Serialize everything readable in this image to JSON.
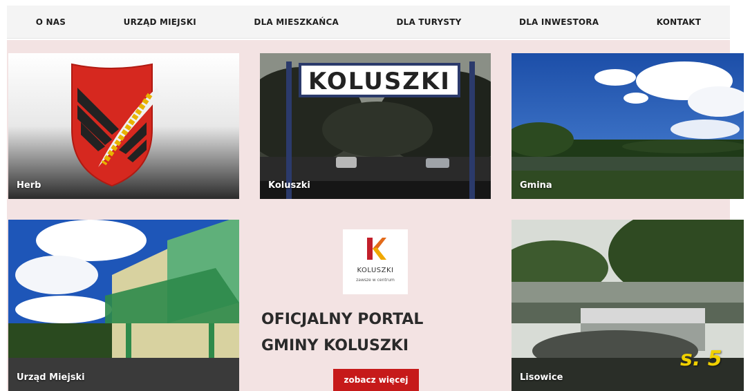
{
  "nav": {
    "items": [
      {
        "label": "O NAS"
      },
      {
        "label": "URZĄD MIEJSKI"
      },
      {
        "label": "DLA MIESZKAŃCA"
      },
      {
        "label": "DLA TURYSTY"
      },
      {
        "label": "DLA INWESTORA"
      },
      {
        "label": "KONTAKT"
      }
    ]
  },
  "tiles": {
    "herb": {
      "label": "Herb"
    },
    "koluszki": {
      "label": "Koluszki",
      "sign_text": "KOLUSZKI"
    },
    "gmina": {
      "label": "Gmina"
    },
    "urzad": {
      "label": "Urząd Miejski"
    },
    "lisowice": {
      "label": "Lisowice"
    }
  },
  "portal": {
    "logo_name": "KOLUSZKI",
    "logo_tagline": "zawsze w centrum",
    "title_line1": "OFICJALNY PORTAL",
    "title_line2": "GMINY KOLUSZKI",
    "button_label": "zobacz więcej"
  },
  "page_marker": "s. 5",
  "colors": {
    "accent": "#c61a1a",
    "page_marker": "#f0d000",
    "background": "#f3e3e3"
  }
}
